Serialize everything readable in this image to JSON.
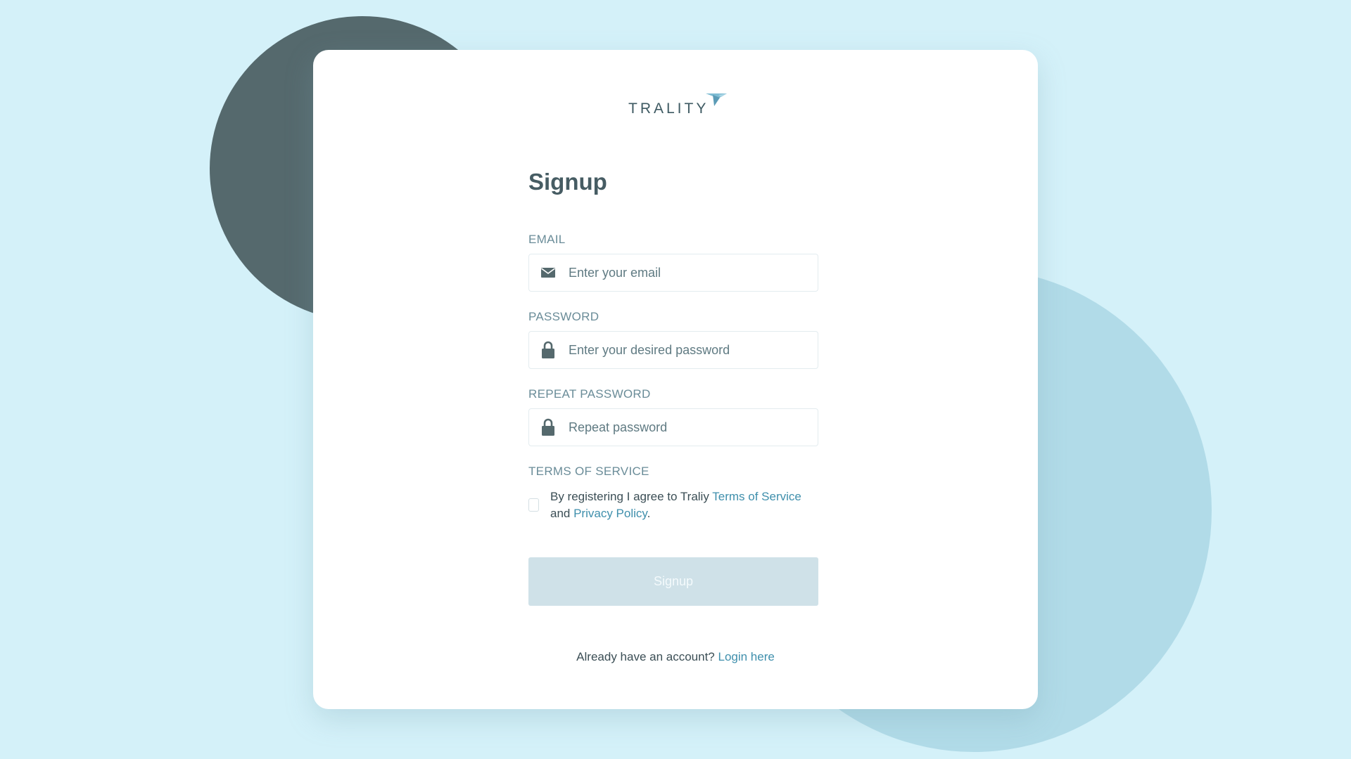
{
  "logo": {
    "text": "TRALITY"
  },
  "form": {
    "title": "Signup",
    "email": {
      "label": "EMAIL",
      "placeholder": "Enter your email",
      "value": "",
      "icon": "envelope-icon"
    },
    "password": {
      "label": "PASSWORD",
      "placeholder": "Enter your desired password",
      "value": "",
      "icon": "lock-icon"
    },
    "repeat_password": {
      "label": "REPEAT PASSWORD",
      "placeholder": "Repeat password",
      "value": "",
      "icon": "lock-icon"
    },
    "terms": {
      "label": "TERMS OF SERVICE",
      "checked": false,
      "text_before": "By registering I agree to Traliy ",
      "tos_link": "Terms of Service",
      "text_and": " and ",
      "privacy_link": "Privacy Policy",
      "text_after": "."
    },
    "submit_label": "Signup"
  },
  "footer": {
    "prompt": "Already have an account? ",
    "login_link": "Login here"
  },
  "colors": {
    "background": "#d4f1f9",
    "blob_dark": "#55696d",
    "blob_light": "#b1dbe8",
    "link": "#3f8fac",
    "button_disabled": "#cfe1e8"
  }
}
